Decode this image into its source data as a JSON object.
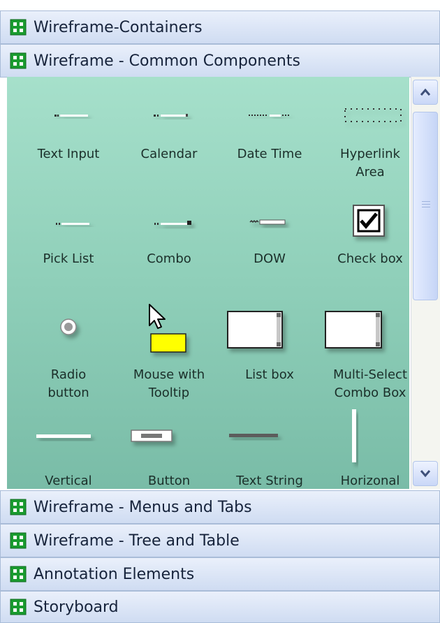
{
  "sections": {
    "containers": "Wireframe-Containers",
    "common_components": "Wireframe - Common Components",
    "menus_tabs": "Wireframe - Menus and Tabs",
    "tree_table": "Wireframe - Tree and Table",
    "annotation": "Annotation Elements",
    "storyboard": "Storyboard"
  },
  "shapes": {
    "text_input": "Text Input",
    "calendar": "Calendar",
    "date_time": "Date Time",
    "hyperlink_area": "Hyperlink\nArea",
    "pick_list": "Pick List",
    "combo": "Combo",
    "dow": "DOW",
    "check_box": "Check box",
    "radio_button": "Radio\nbutton",
    "mouse_tooltip": "Mouse with\nTooltip",
    "list_box": "List box",
    "multi_select": "Multi-Select\nCombo Box",
    "vertical": "Vertical",
    "button": "Button",
    "text_string": "Text String",
    "horizonal": "Horizonal"
  },
  "colors": {
    "stencil_icon": "#1a9b2f",
    "content_background": "#8fcfb9",
    "tooltip_fill": "#ffff00"
  },
  "icons": {
    "section": "stencil-grid-icon",
    "scroll_up": "chevron-up-icon",
    "scroll_down": "chevron-down-icon",
    "cursor": "mouse-pointer-icon"
  }
}
